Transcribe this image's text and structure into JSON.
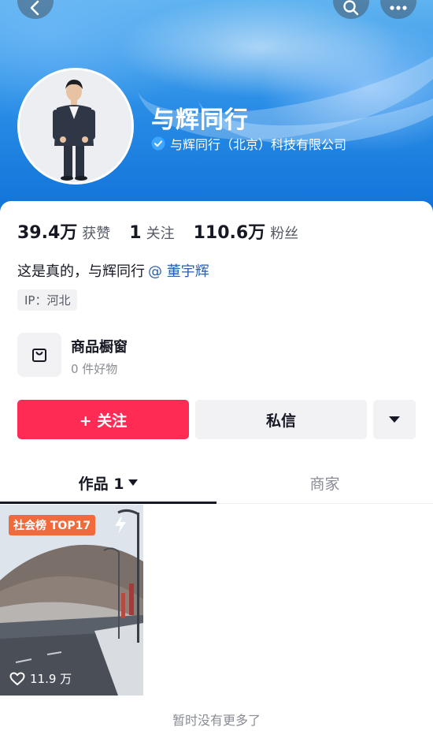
{
  "header": {
    "profile_name": "与辉同行",
    "verified_org": "与辉同行（北京）科技有限公司"
  },
  "icons": {
    "back": "chevron-left-icon",
    "search": "search-icon",
    "more": "more-dots-icon",
    "verified": "verified-check-icon",
    "shop": "shopping-bag-icon",
    "dropdown": "caret-down-icon",
    "bolt": "lightning-icon",
    "heart": "heart-icon"
  },
  "stats": {
    "likes_num": "39.4万",
    "likes_label": "获赞",
    "following_num": "1",
    "following_label": "关注",
    "followers_num": "110.6万",
    "followers_label": "粉丝"
  },
  "bio": {
    "text": "这是真的，与辉同行",
    "mention": "@ 董宇辉"
  },
  "ip": {
    "label": "IP：河北"
  },
  "shop": {
    "title": "商品橱窗",
    "subtitle": "0 件好物"
  },
  "actions": {
    "follow_label": "+ 关注",
    "message_label": "私信"
  },
  "tabs": {
    "works_label": "作品 1",
    "merchant_label": "商家"
  },
  "video": {
    "rank_badge": "社会榜 TOP17",
    "likes": "11.9 万"
  },
  "footer": {
    "no_more": "暂时没有更多了"
  },
  "colors": {
    "accent": "#fe2c55",
    "mention": "#2b5fa8",
    "badge": "#f06a3b"
  }
}
